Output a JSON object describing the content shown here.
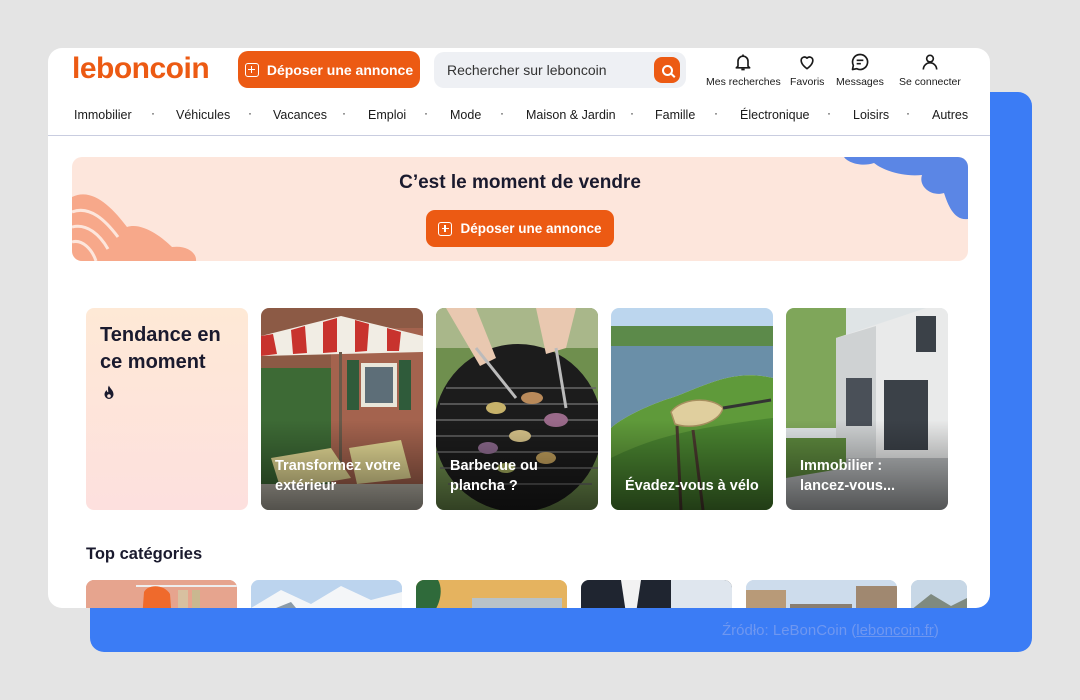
{
  "brand": {
    "logo": "leboncoin",
    "accent": "#ec5a13"
  },
  "header": {
    "deposit_label": "Déposer une annonce",
    "search_placeholder": "Rechercher sur leboncoin",
    "items": [
      {
        "label": "Mes recherches",
        "icon": "bell-icon"
      },
      {
        "label": "Favoris",
        "icon": "heart-icon"
      },
      {
        "label": "Messages",
        "icon": "chat-icon"
      },
      {
        "label": "Se connecter",
        "icon": "user-icon"
      }
    ]
  },
  "nav": {
    "items": [
      "Immobilier",
      "Véhicules",
      "Vacances",
      "Emploi",
      "Mode",
      "Maison & Jardin",
      "Famille",
      "Électronique",
      "Loisirs",
      "Autres"
    ],
    "separator": "·"
  },
  "banner": {
    "title": "C’est le moment de vendre",
    "button_label": "Déposer une annonce"
  },
  "trending": {
    "title": "Tendance en ce moment",
    "icon": "flame-icon",
    "cards": [
      {
        "caption": "Transformez votre extérieur"
      },
      {
        "caption": "Barbecue ou plancha ?"
      },
      {
        "caption": "Évadez-vous à vélo"
      },
      {
        "caption": "Immobilier : lancez-vous..."
      }
    ]
  },
  "top_categories": {
    "title": "Top catégories"
  },
  "source": {
    "prefix": "Źródło: LeBonCoin (",
    "link": "leboncoin.fr",
    "suffix": ")"
  }
}
